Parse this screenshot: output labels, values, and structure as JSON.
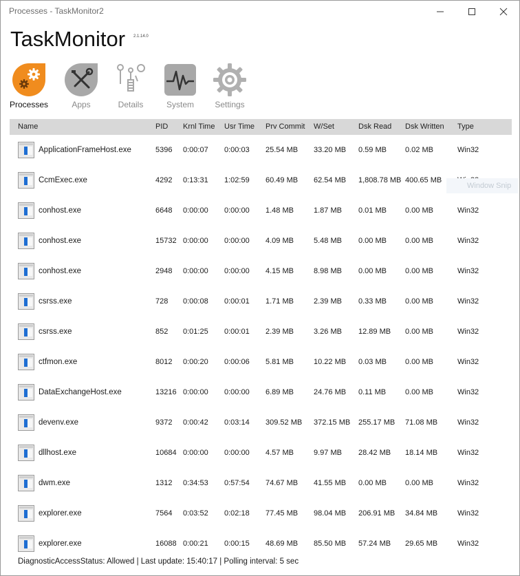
{
  "window": {
    "title": "Processes - TaskMonitor2"
  },
  "app": {
    "name": "TaskMonitor",
    "version": "2.1.14.0"
  },
  "nav": [
    {
      "label": "Processes",
      "icon": "processes-gear-icon"
    },
    {
      "label": "Apps",
      "icon": "apps-tools-icon"
    },
    {
      "label": "Details",
      "icon": "details-screws-icon"
    },
    {
      "label": "System",
      "icon": "system-pulse-icon"
    },
    {
      "label": "Settings",
      "icon": "settings-gear-icon"
    }
  ],
  "columns": [
    "Name",
    "PID",
    "Krnl Time",
    "Usr Time",
    "Prv Commit",
    "W/Set",
    "Dsk Read",
    "Dsk Written",
    "Type"
  ],
  "rows": [
    {
      "name": "ApplicationFrameHost.exe",
      "pid": "5396",
      "krnl": "0:00:07",
      "usr": "0:00:03",
      "prv": "25.54 MB",
      "wset": "33.20 MB",
      "read": "0.59 MB",
      "written": "0.02 MB",
      "type": "Win32"
    },
    {
      "name": "CcmExec.exe",
      "pid": "4292",
      "krnl": "0:13:31",
      "usr": "1:02:59",
      "prv": "60.49 MB",
      "wset": "62.54 MB",
      "read": "1,808.78 MB",
      "written": "400.65 MB",
      "type": "Win32"
    },
    {
      "name": "conhost.exe",
      "pid": "6648",
      "krnl": "0:00:00",
      "usr": "0:00:00",
      "prv": "1.48 MB",
      "wset": "1.87 MB",
      "read": "0.01 MB",
      "written": "0.00 MB",
      "type": "Win32"
    },
    {
      "name": "conhost.exe",
      "pid": "15732",
      "krnl": "0:00:00",
      "usr": "0:00:00",
      "prv": "4.09 MB",
      "wset": "5.48 MB",
      "read": "0.00 MB",
      "written": "0.00 MB",
      "type": "Win32"
    },
    {
      "name": "conhost.exe",
      "pid": "2948",
      "krnl": "0:00:00",
      "usr": "0:00:00",
      "prv": "4.15 MB",
      "wset": "8.98 MB",
      "read": "0.00 MB",
      "written": "0.00 MB",
      "type": "Win32"
    },
    {
      "name": "csrss.exe",
      "pid": "728",
      "krnl": "0:00:08",
      "usr": "0:00:01",
      "prv": "1.71 MB",
      "wset": "2.39 MB",
      "read": "0.33 MB",
      "written": "0.00 MB",
      "type": "Win32"
    },
    {
      "name": "csrss.exe",
      "pid": "852",
      "krnl": "0:01:25",
      "usr": "0:00:01",
      "prv": "2.39 MB",
      "wset": "3.26 MB",
      "read": "12.89 MB",
      "written": "0.00 MB",
      "type": "Win32"
    },
    {
      "name": "ctfmon.exe",
      "pid": "8012",
      "krnl": "0:00:20",
      "usr": "0:00:06",
      "prv": "5.81 MB",
      "wset": "10.22 MB",
      "read": "0.03 MB",
      "written": "0.00 MB",
      "type": "Win32"
    },
    {
      "name": "DataExchangeHost.exe",
      "pid": "13216",
      "krnl": "0:00:00",
      "usr": "0:00:00",
      "prv": "6.89 MB",
      "wset": "24.76 MB",
      "read": "0.11 MB",
      "written": "0.00 MB",
      "type": "Win32"
    },
    {
      "name": "devenv.exe",
      "pid": "9372",
      "krnl": "0:00:42",
      "usr": "0:03:14",
      "prv": "309.52 MB",
      "wset": "372.15 MB",
      "read": "255.17 MB",
      "written": "71.08 MB",
      "type": "Win32"
    },
    {
      "name": "dllhost.exe",
      "pid": "10684",
      "krnl": "0:00:00",
      "usr": "0:00:00",
      "prv": "4.57 MB",
      "wset": "9.97 MB",
      "read": "28.42 MB",
      "written": "18.14 MB",
      "type": "Win32"
    },
    {
      "name": "dwm.exe",
      "pid": "1312",
      "krnl": "0:34:53",
      "usr": "0:57:54",
      "prv": "74.67 MB",
      "wset": "41.55 MB",
      "read": "0.00 MB",
      "written": "0.00 MB",
      "type": "Win32"
    },
    {
      "name": "explorer.exe",
      "pid": "7564",
      "krnl": "0:03:52",
      "usr": "0:02:18",
      "prv": "77.45 MB",
      "wset": "98.04 MB",
      "read": "206.91 MB",
      "written": "34.84 MB",
      "type": "Win32"
    },
    {
      "name": "explorer.exe",
      "pid": "16088",
      "krnl": "0:00:21",
      "usr": "0:00:15",
      "prv": "48.69 MB",
      "wset": "85.50 MB",
      "read": "57.24 MB",
      "written": "29.65 MB",
      "type": "Win32"
    }
  ],
  "status": "DiagnosticAccessStatus: Allowed  |  Last update: 15:40:17  |  Polling interval: 5 sec",
  "overlay": {
    "snip_label": "Window Snip"
  },
  "colors": {
    "accent": "#f08c1e",
    "header_bg": "#d8d8d8",
    "icon_gray": "#a8a8a8",
    "process_icon_blue": "#1e6ed2"
  }
}
